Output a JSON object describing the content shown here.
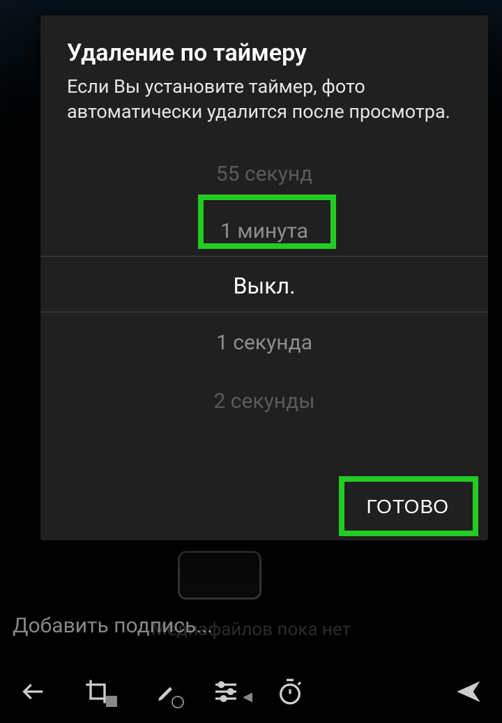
{
  "modal": {
    "title": "Удаление по таймеру",
    "description": "Если Вы установите таймер, фото автоматически удалится после просмотра.",
    "picker": {
      "minus2": "55 секунд",
      "minus1": "1 минута",
      "center": "Выкл.",
      "plus1": "1 секунда",
      "plus2": "2 секунды"
    },
    "done": "ГОТОВО"
  },
  "background": {
    "caption_placeholder": "Добавить подпись...",
    "no_media": "Медиафайлов пока нет"
  },
  "highlight_color": "#22cc22"
}
